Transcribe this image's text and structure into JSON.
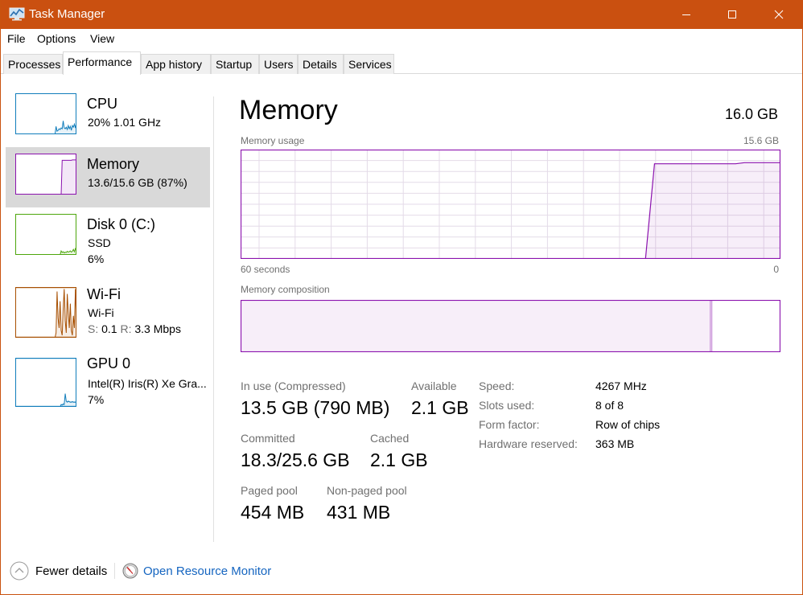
{
  "window": {
    "title": "Task Manager",
    "accent_color": "#ca5010",
    "controls": [
      "minimize",
      "maximize",
      "close"
    ]
  },
  "menu": [
    "File",
    "Options",
    "View"
  ],
  "tabs": [
    {
      "label": "Processes",
      "active": false
    },
    {
      "label": "Performance",
      "active": true
    },
    {
      "label": "App history",
      "active": false
    },
    {
      "label": "Startup",
      "active": false
    },
    {
      "label": "Users",
      "active": false
    },
    {
      "label": "Details",
      "active": false
    },
    {
      "label": "Services",
      "active": false
    }
  ],
  "sidebar": {
    "items": [
      {
        "title": "CPU",
        "line1": "20%  1.01 GHz",
        "color": "#117dbb",
        "selected": false,
        "history": [
          0,
          0,
          0,
          0,
          0,
          0,
          0,
          0,
          0,
          0,
          0,
          0,
          0,
          0,
          0,
          0,
          0,
          0,
          0,
          0,
          0,
          0,
          0,
          0,
          0,
          0,
          0,
          0,
          0,
          0,
          0,
          0,
          0,
          0,
          0,
          0,
          0,
          0,
          0,
          0,
          20,
          8,
          10,
          14,
          12,
          16,
          14,
          34,
          16,
          14,
          18,
          12,
          22,
          14,
          20,
          10,
          22,
          18,
          26,
          16,
          30
        ]
      },
      {
        "title": "Memory",
        "line1": "13.6/15.6 GB (87%)",
        "color": "#8b12ae",
        "selected": true,
        "history_percent": [
          0,
          0,
          0,
          0,
          0,
          0,
          0,
          0,
          0,
          0,
          0,
          0,
          0,
          0,
          0,
          0,
          0,
          0,
          0,
          0,
          0,
          0,
          0,
          0,
          0,
          0,
          0,
          0,
          0,
          0,
          0,
          0,
          0,
          0,
          0,
          0,
          0,
          0,
          0,
          0,
          0,
          0,
          0,
          0,
          0,
          0,
          87,
          87,
          87,
          87,
          87,
          87,
          87,
          87,
          87,
          87,
          88,
          88,
          88,
          88,
          88
        ]
      },
      {
        "title": "Disk 0 (C:)",
        "line1": "SSD",
        "line2": "6%",
        "color": "#4da60c",
        "selected": false,
        "history": [
          0,
          0,
          0,
          0,
          0,
          0,
          0,
          0,
          0,
          0,
          0,
          0,
          0,
          0,
          0,
          0,
          0,
          0,
          0,
          0,
          0,
          0,
          0,
          0,
          0,
          0,
          0,
          0,
          0,
          0,
          0,
          0,
          0,
          0,
          0,
          0,
          0,
          0,
          0,
          0,
          0,
          0,
          0,
          0,
          0,
          10,
          6,
          8,
          5,
          7,
          6,
          9,
          7,
          8,
          10,
          7,
          9,
          14,
          8,
          16,
          12
        ]
      },
      {
        "title": "Wi-Fi",
        "line1": "Wi-Fi",
        "send_label": "S:",
        "send_value": "0.1",
        "recv_label": "R:",
        "recv_value": "3.3 Mbps",
        "color": "#a74f01",
        "selected": false,
        "history": [
          0,
          0,
          0,
          0,
          0,
          0,
          0,
          0,
          0,
          0,
          0,
          0,
          0,
          0,
          0,
          0,
          0,
          0,
          0,
          0,
          0,
          0,
          0,
          0,
          0,
          0,
          0,
          0,
          0,
          0,
          0,
          0,
          0,
          0,
          0,
          0,
          0,
          0,
          0,
          0,
          10,
          95,
          40,
          20,
          75,
          15,
          5,
          60,
          100,
          35,
          10,
          90,
          50,
          20,
          70,
          15,
          5,
          45,
          20,
          100,
          30
        ]
      },
      {
        "title": "GPU 0",
        "line1": "Intel(R) Iris(R) Xe Gra...",
        "line2": "7%",
        "color": "#117dbb",
        "selected": false,
        "history": [
          0,
          0,
          0,
          0,
          0,
          0,
          0,
          0,
          0,
          0,
          0,
          0,
          0,
          0,
          0,
          0,
          0,
          0,
          0,
          0,
          0,
          0,
          0,
          0,
          0,
          0,
          0,
          0,
          0,
          0,
          0,
          0,
          0,
          0,
          0,
          0,
          0,
          0,
          0,
          0,
          0,
          0,
          0,
          0,
          0,
          5,
          4,
          6,
          5,
          28,
          12,
          10,
          12,
          11,
          10,
          10,
          11,
          10,
          10,
          10,
          10
        ]
      }
    ]
  },
  "main": {
    "title": "Memory",
    "total": "16.0 GB",
    "usage_label": "Memory usage",
    "usage_max": "15.6 GB",
    "time_left": "60 seconds",
    "time_right": "0",
    "composition_label": "Memory composition",
    "graph_color": "#8b12ae",
    "composition": {
      "in_use_fraction": 0.87,
      "modified_fraction": 0.003,
      "standby_fraction": 0.0,
      "free_fraction": 0.127
    },
    "stats": {
      "in_use_label": "In use (Compressed)",
      "in_use_value": "13.5 GB (790 MB)",
      "available_label": "Available",
      "available_value": "2.1 GB",
      "committed_label": "Committed",
      "committed_value": "18.3/25.6 GB",
      "cached_label": "Cached",
      "cached_value": "2.1 GB",
      "paged_label": "Paged pool",
      "paged_value": "454 MB",
      "nonpaged_label": "Non-paged pool",
      "nonpaged_value": "431 MB"
    },
    "specs": [
      {
        "label": "Speed:",
        "value": "4267 MHz"
      },
      {
        "label": "Slots used:",
        "value": "8 of 8"
      },
      {
        "label": "Form factor:",
        "value": "Row of chips"
      },
      {
        "label": "Hardware reserved:",
        "value": "363 MB"
      }
    ]
  },
  "footer": {
    "fewer_details": "Fewer details",
    "open_resource_monitor": "Open Resource Monitor"
  }
}
